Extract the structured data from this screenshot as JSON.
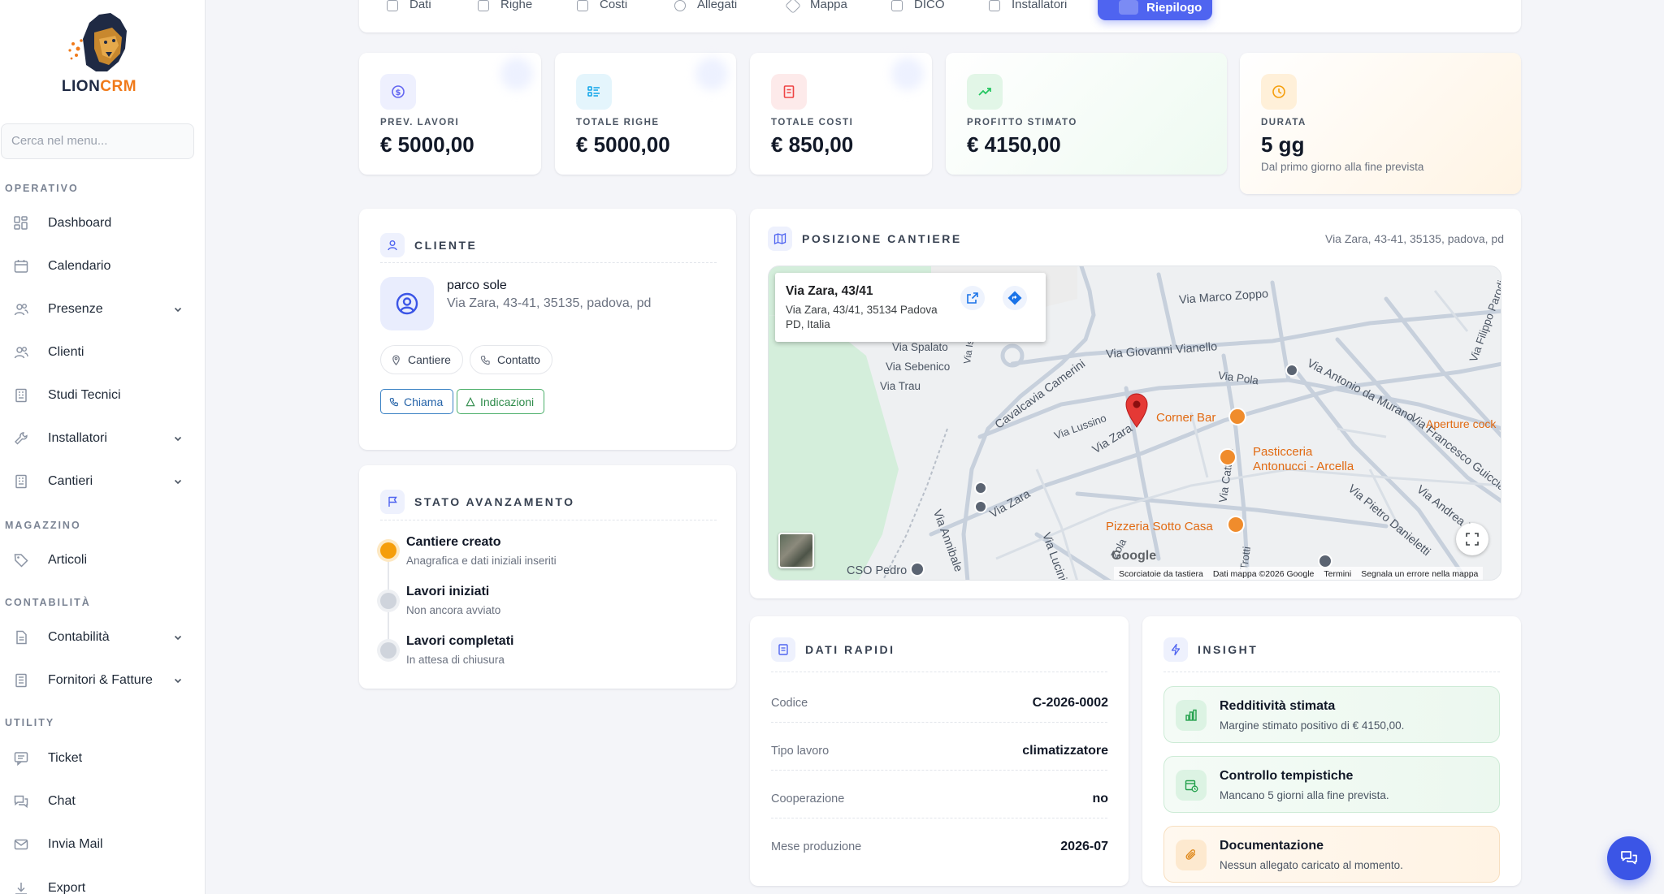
{
  "brand": {
    "name_part1": "LION",
    "name_part2": "CRM"
  },
  "sidebar": {
    "search_placeholder": "Cerca nel menu...",
    "sections": [
      "OPERATIVO",
      "MAGAZZINO",
      "CONTABILITÀ",
      "UTILITY"
    ],
    "items": [
      {
        "label": "Dashboard",
        "icon": "dashboard-icon"
      },
      {
        "label": "Calendario",
        "icon": "calendar-icon"
      },
      {
        "label": "Presenze",
        "icon": "users-icon",
        "expandable": true
      },
      {
        "label": "Clienti",
        "icon": "users-icon"
      },
      {
        "label": "Studi Tecnici",
        "icon": "building-icon"
      },
      {
        "label": "Installatori",
        "icon": "wrench-icon",
        "expandable": true
      },
      {
        "label": "Cantieri",
        "icon": "building-icon",
        "expandable": true
      },
      {
        "label": "Articoli",
        "icon": "tag-icon"
      },
      {
        "label": "Contabilità",
        "icon": "document-icon",
        "expandable": true
      },
      {
        "label": "Fornitori & Fatture",
        "icon": "building-icon",
        "expandable": true
      },
      {
        "label": "Ticket",
        "icon": "message-icon"
      },
      {
        "label": "Chat",
        "icon": "chat-icon"
      },
      {
        "label": "Invia Mail",
        "icon": "mail-icon"
      },
      {
        "label": "Export",
        "icon": "download-icon"
      }
    ]
  },
  "tabs": [
    {
      "label": "Dati"
    },
    {
      "label": "Righe"
    },
    {
      "label": "Costi"
    },
    {
      "label": "Allegati"
    },
    {
      "label": "Mappa"
    },
    {
      "label": "DICO"
    },
    {
      "label": "Installatori"
    },
    {
      "label": "Riepilogo",
      "active": true
    }
  ],
  "stats": [
    {
      "label": "PREV. LAVORI",
      "value": "€ 5000,00",
      "icon": "dollar-icon",
      "color": "#6366f1"
    },
    {
      "label": "TOTALE RIGHE",
      "value": "€ 5000,00",
      "icon": "list-icon",
      "color": "#0ea5e9"
    },
    {
      "label": "TOTALE COSTI",
      "value": "€ 850,00",
      "icon": "receipt-icon",
      "color": "#ef4444"
    },
    {
      "label": "PROFITTO STIMATO",
      "value": "€ 4150,00",
      "icon": "trend-up-icon",
      "color": "#22c55e"
    },
    {
      "label": "DURATA",
      "value": "5 gg",
      "sub": "Dal primo giorno alla fine prevista",
      "icon": "clock-icon",
      "color": "#f59e0b"
    }
  ],
  "cliente": {
    "title": "CLIENTE",
    "name": "parco sole",
    "address": "Via Zara, 43-41, 35135, padova, pd",
    "pill_cantiere": "Cantiere",
    "pill_contatto": "Contatto",
    "btn_chiama": "Chiama",
    "btn_indicazioni": "Indicazioni"
  },
  "stato": {
    "title": "STATO AVANZAMENTO",
    "steps": [
      {
        "title": "Cantiere creato",
        "sub": "Anagrafica e dati iniziali inseriti",
        "done": true
      },
      {
        "title": "Lavori iniziati",
        "sub": "Non ancora avviato",
        "done": false
      },
      {
        "title": "Lavori completati",
        "sub": "In attesa di chiusura",
        "done": false
      }
    ]
  },
  "posizione": {
    "title": "POSIZIONE CANTIERE",
    "address": "Via Zara, 43-41, 35135, padova, pd",
    "popup_title": "Via Zara, 43/41",
    "popup_addr1": "Via Zara, 43/41, 35134 Padova",
    "popup_addr2": "PD, Italia",
    "streets": [
      "Via Marco Zoppo",
      "Via Filippo Parodi",
      "Via Spalato",
      "Via Giovanni Vianello",
      "Via Sebenico",
      "Via Pola",
      "Via Antonio da Murano",
      "Via Trau",
      "Cavalcavia Camerini",
      "Via Istria",
      "Via Lussino",
      "Via Zara",
      "Via Zara",
      "Via Cattaro",
      "Via Francesco Guicciardini",
      "Via Andrea P.",
      "Via Pietro Danieletti",
      "Via Annibale",
      "Via Lucini",
      "CSO Pedro",
      "Zola",
      "Trotti"
    ],
    "pois": [
      "Corner Bar",
      "Pasticceria",
      "Antonucci - Arcella",
      "Pizzeria Sotto Casa",
      "Aperture cock"
    ],
    "footer": [
      "Scorciatoie da tastiera",
      "Dati mappa ©2026 Google",
      "Termini",
      "Segnala un errore nella mappa"
    ],
    "google": "Google"
  },
  "dati_rapidi": {
    "title": "DATI RAPIDI",
    "rows": [
      {
        "label": "Codice",
        "value": "C-2026-0002"
      },
      {
        "label": "Tipo lavoro",
        "value": "climatizzatore"
      },
      {
        "label": "Cooperazione",
        "value": "no"
      },
      {
        "label": "Mese produzione",
        "value": "2026-07"
      }
    ]
  },
  "insight": {
    "title": "INSIGHT",
    "items": [
      {
        "title": "Redditività stimata",
        "sub": "Margine stimato positivo di € 4150,00."
      },
      {
        "title": "Controllo tempistiche",
        "sub": "Mancano 5 giorni alla fine prevista."
      },
      {
        "title": "Documentazione",
        "sub": "Nessun allegato caricato al momento."
      }
    ]
  }
}
